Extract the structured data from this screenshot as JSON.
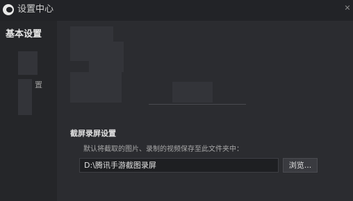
{
  "window": {
    "title": "设置中心",
    "close_label": "✕"
  },
  "sidebar": {
    "items": [
      {
        "label": "基本设置"
      },
      {
        "label": "置"
      }
    ]
  },
  "screenshot_settings": {
    "section_title": "截屏录屏设置",
    "description": "默认将截取的图片、录制的视频保存至此文件夹中：",
    "path_value": "D:\\腾讯手游截图录屏",
    "browse_label": "浏览..."
  }
}
